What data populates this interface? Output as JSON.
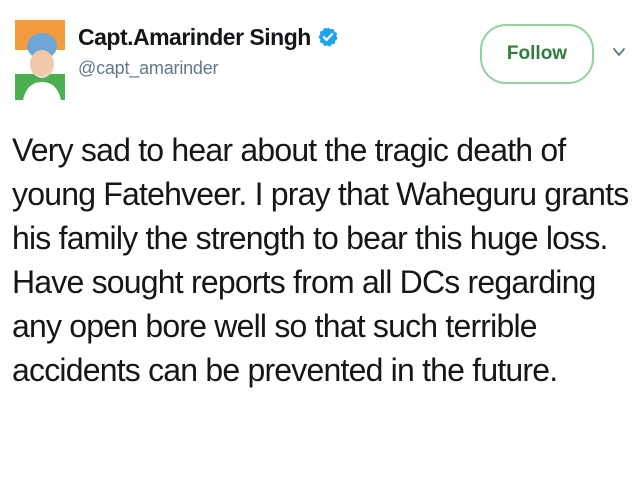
{
  "author": {
    "display_name": "Capt.Amarinder Singh",
    "handle": "@capt_amarinder",
    "avatar": "avatar-photo",
    "verified_icon": "verified-badge-icon"
  },
  "actions": {
    "follow_label": "Follow",
    "menu_icon": "chevron-down-icon"
  },
  "tweet": {
    "lines": [
      "Very sad to hear about the tragic death of",
      "young Fatehveer. I pray that Waheguru grants",
      "his family the strength to bear this huge loss.",
      "Have sought reports from all DCs regarding",
      "any open bore well so that such terrible",
      "accidents can be prevented in the future."
    ]
  },
  "colors": {
    "verified_blue": "#1da1f2",
    "follow_border": "#8fd39f",
    "follow_text": "#2f7d40",
    "handle_gray": "#657786"
  }
}
